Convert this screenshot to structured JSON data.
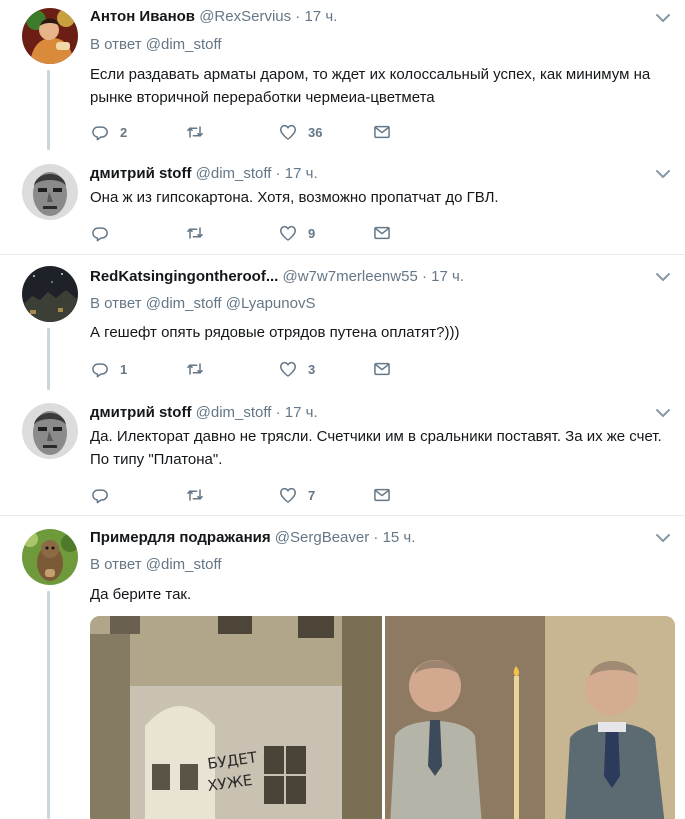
{
  "tweets": [
    {
      "name": "Антон Иванов",
      "handle": "@RexServius",
      "dot": "·",
      "time": "17 ч.",
      "reply_prefix": "В ответ",
      "reply_to": "@dim_stoff",
      "text": "Если раздавать арматы даром, то ждет их колоссальный успех, как минимум на рынке вторичной переработки чермеиа-цветмета",
      "replies": "2",
      "retweets": "",
      "likes": "36"
    },
    {
      "name": "дмитрий stoff",
      "handle": "@dim_stoff",
      "dot": "·",
      "time": "17 ч.",
      "text": "Она ж из гипсокартона. Хотя, возможно пропатчат до ГВЛ.",
      "replies": "",
      "retweets": "",
      "likes": "9"
    },
    {
      "name": "RedKatsingingontheroof...",
      "handle": "@w7w7merleenw55",
      "dot": "·",
      "time": "17 ч.",
      "reply_prefix": "В ответ",
      "reply_to": "@dim_stoff @LyapunovS",
      "text": "А гешефт опять рядовые отрядов путена оплатят?)))",
      "replies": "1",
      "retweets": "",
      "likes": "3"
    },
    {
      "name": "дмитрий stoff",
      "handle": "@dim_stoff",
      "dot": "·",
      "time": "17 ч.",
      "text": "Да. Илекторат давно не трясли. Счетчики им в сральники поставят. За их же счет. По типу \"Платона\".",
      "replies": "",
      "retweets": "",
      "likes": "7"
    },
    {
      "name": "Примердля подражания",
      "handle": "@SergBeaver",
      "dot": "·",
      "time": "15 ч.",
      "reply_prefix": "В ответ",
      "reply_to": "@dim_stoff",
      "text": "Да берите так.",
      "graffiti": "БУДЕТ ХУЖЕ"
    }
  ],
  "icons": {
    "reply": "reply-icon",
    "retweet": "retweet-icon",
    "like": "heart-icon",
    "dm": "envelope-icon",
    "caret": "chevron-down-icon"
  },
  "colors": {
    "text": "#14171a",
    "muted": "#657786",
    "divider": "#e6ecf0",
    "thread": "#ccd6dd"
  }
}
